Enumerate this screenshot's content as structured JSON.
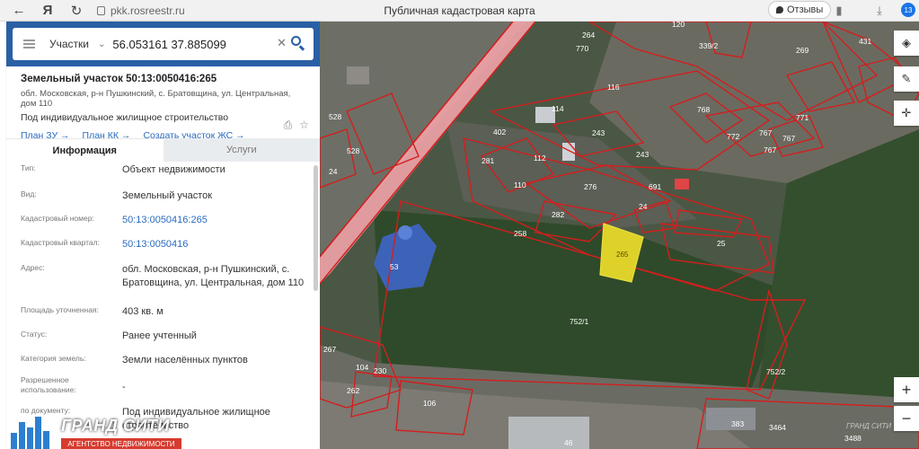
{
  "browser": {
    "url": "pkk.rosreestr.ru",
    "page_title": "Публичная кадастровая карта",
    "reviews_label": "Отзывы",
    "downloads_count": "13"
  },
  "search": {
    "mode": "Участки",
    "value": "56.053161 37.885099"
  },
  "plot": {
    "title": "Земельный участок 50:13:0050416:265",
    "address_short": "обл. Московская, р-н Пушкинский, с. Братовщина, ул. Центральная, дом 110",
    "use": "Под индивидуальное жилищное строительство",
    "links": [
      "План ЗУ →",
      "План КК →",
      "Создать участок ЖС →"
    ]
  },
  "tabs": [
    "Информация",
    "Услуги"
  ],
  "info_rows": [
    {
      "label": "Тип:",
      "value": "Объект недвижимости"
    },
    {
      "label": "Вид:",
      "value": "Земельный участок"
    },
    {
      "label": "Кадастровый номер:",
      "value": "50:13:0050416:265"
    },
    {
      "label": "Кадастровый квартал:",
      "value": "50:13:0050416"
    },
    {
      "label": "Адрес:",
      "value": "обл. Московская, р-н Пушкинский, с. Братовщина, ул. Центральная, дом 110"
    },
    {
      "label": "Площадь уточненная:",
      "value": "403 кв. м"
    },
    {
      "label": "Статус:",
      "value": "Ранее учтенный"
    },
    {
      "label": "Категория земель:",
      "value": "Земли населённых пунктов"
    },
    {
      "label": "Разрешенное использование:",
      "value": "-"
    },
    {
      "label": "по документу:",
      "value": "Под индивидуальное жилищное строительство"
    }
  ],
  "logo": {
    "brand": "ГРАНД СИТИ",
    "subtitle": "АГЕНТСТВО НЕДВИЖИМОСТИ"
  },
  "map": {
    "selected_parcel": "265",
    "labels": [
      "120",
      "264",
      "770",
      "339/2",
      "269",
      "431",
      "116",
      "114",
      "243",
      "768",
      "771",
      "402",
      "112",
      "772",
      "767",
      "767",
      "767",
      "528",
      "281",
      "243",
      "110",
      "276",
      "691",
      "528",
      "24",
      "282",
      "258",
      "25",
      "24",
      "53",
      "752/1",
      "267",
      "104",
      "230",
      "752/2",
      "262",
      "106",
      "383",
      "3464",
      "46",
      "3488"
    ],
    "watermark": "ГРАНД СИТИ",
    "accent": "#e8d92a",
    "boundary_color": "#d41e1e"
  }
}
